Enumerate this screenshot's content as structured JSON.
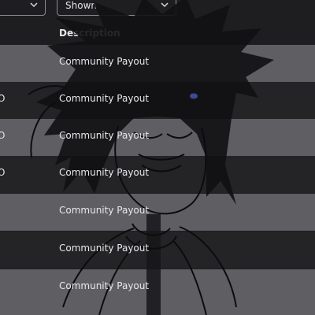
{
  "filters": {
    "left_select": {
      "value": "",
      "icon": "chevron-down-icon"
    },
    "right_select": {
      "value": "Shown",
      "icon": "chevron-down-icon"
    }
  },
  "table": {
    "header": {
      "description": "Description"
    },
    "rows": [
      {
        "prefix": "",
        "description": "Community Payout"
      },
      {
        "prefix": "O",
        "description": "Community Payout"
      },
      {
        "prefix": "O",
        "description": "Community Payout"
      },
      {
        "prefix": "O",
        "description": "Community Payout"
      },
      {
        "prefix": "",
        "description": "Community Payout"
      },
      {
        "prefix": "",
        "description": "Community Payout"
      },
      {
        "prefix": "",
        "description": "Community Payout"
      }
    ]
  },
  "colors": {
    "page_background": "#1e1e21",
    "row_light": "#5f5f63",
    "row_dark": "#242427",
    "text": "#e8e8ec",
    "art_fill": "#111113",
    "art_line": "#0c0c0e",
    "art_accent": "#3b4a9a"
  }
}
